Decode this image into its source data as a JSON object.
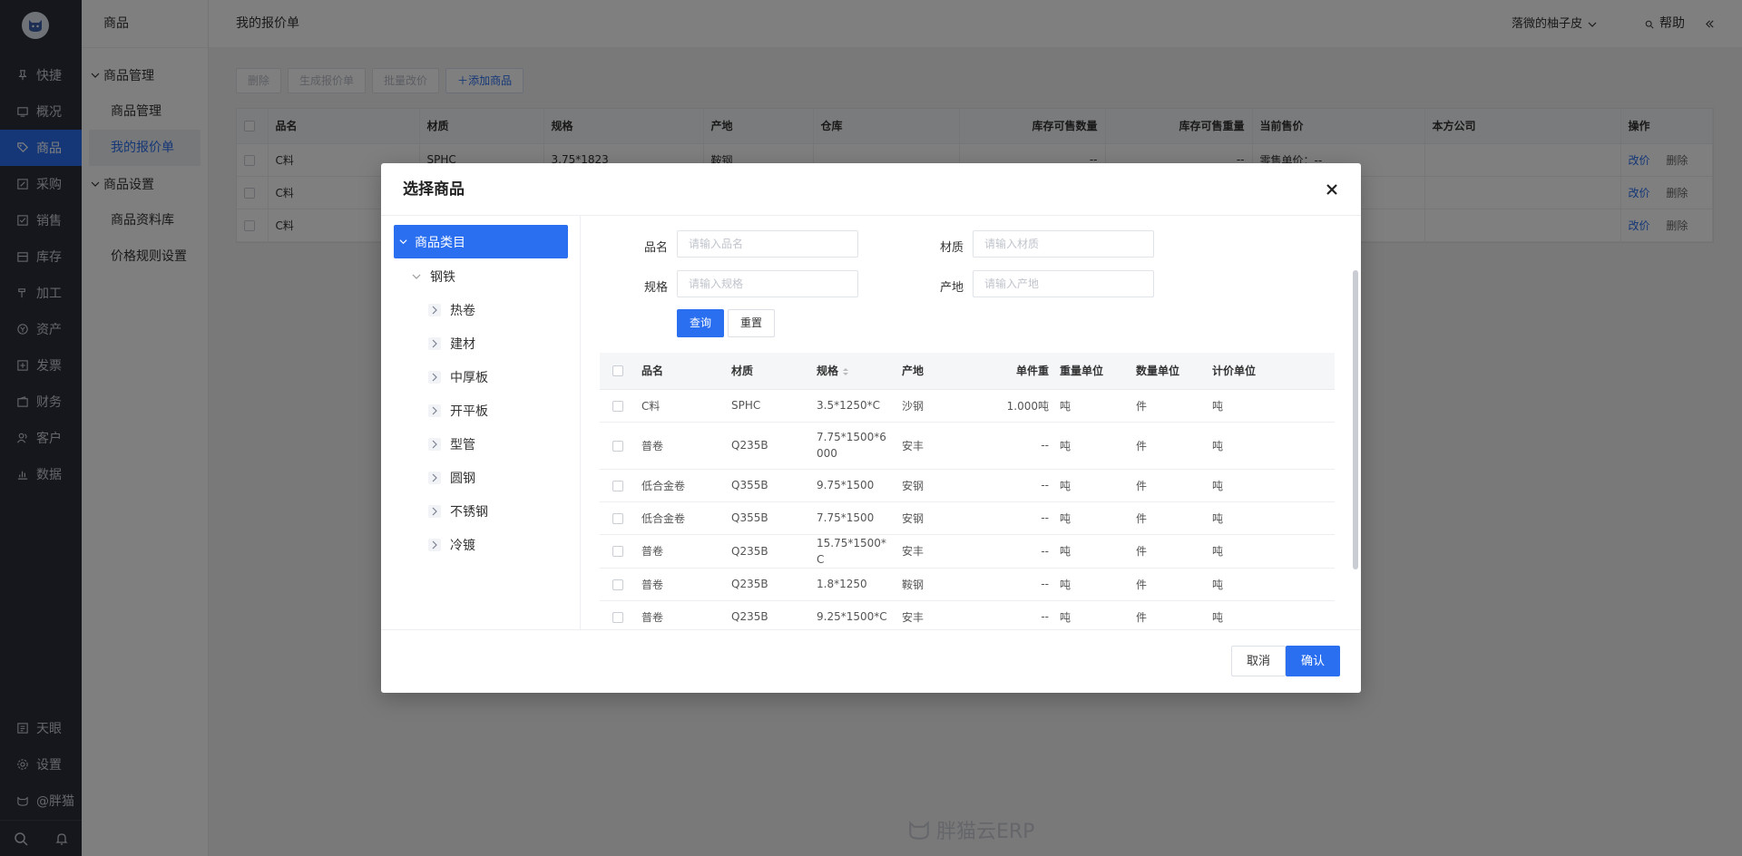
{
  "sidebar": {
    "items": [
      {
        "label": "快捷",
        "icon": "pin-icon"
      },
      {
        "label": "概况",
        "icon": "monitor-icon"
      },
      {
        "label": "商品",
        "icon": "tag-icon",
        "active": true
      },
      {
        "label": "采购",
        "icon": "edit-box-icon"
      },
      {
        "label": "销售",
        "icon": "check-box-icon"
      },
      {
        "label": "库存",
        "icon": "warehouse-icon"
      },
      {
        "label": "加工",
        "icon": "hammer-icon"
      },
      {
        "label": "资产",
        "icon": "coin-icon"
      },
      {
        "label": "发票",
        "icon": "invoice-icon"
      },
      {
        "label": "财务",
        "icon": "wallet-icon"
      },
      {
        "label": "客户",
        "icon": "user-icon"
      },
      {
        "label": "数据",
        "icon": "chart-icon"
      }
    ],
    "bottom": [
      {
        "label": "天眼",
        "icon": "document-icon"
      },
      {
        "label": "设置",
        "icon": "gear-icon"
      },
      {
        "label": "@胖猫",
        "icon": "cat-icon"
      }
    ]
  },
  "submenu": {
    "title": "商品",
    "groups": [
      {
        "label": "商品管理",
        "items": [
          "商品管理",
          "我的报价单"
        ]
      },
      {
        "label": "商品设置",
        "items": [
          "商品资料库",
          "价格规则设置"
        ]
      }
    ]
  },
  "topbar": {
    "breadcrumb": "我的报价单",
    "user": "落微的柚子皮",
    "help": "帮助"
  },
  "toolbar": {
    "delete": "删除",
    "generate": "生成报价单",
    "batch": "批量改价",
    "add": "添加商品"
  },
  "grid": {
    "headers": [
      "品名",
      "材质",
      "规格",
      "产地",
      "仓库",
      "库存可售数量",
      "库存可售重量",
      "当前售价",
      "本方公司",
      "操作"
    ],
    "rows": [
      [
        "C料",
        "SPHC",
        "3.75*1823",
        "鞍钢",
        "",
        "--",
        "--",
        "零售单价：--",
        ""
      ],
      [
        "C料",
        "",
        "",
        "",
        "",
        "",
        "",
        "",
        ""
      ],
      [
        "C料",
        "",
        "",
        "",
        "",
        "",
        "",
        "",
        ""
      ]
    ],
    "action_edit": "改价",
    "action_delete": "删除"
  },
  "watermark": "胖猫云ERP",
  "modal": {
    "title": "选择商品",
    "tree": {
      "root": "商品类目",
      "child": "钢铁",
      "leaves": [
        "热卷",
        "建材",
        "中厚板",
        "开平板",
        "型管",
        "圆钢",
        "不锈钢",
        "冷镀"
      ]
    },
    "filters": {
      "name_label": "品名",
      "name_placeholder": "请输入品名",
      "material_label": "材质",
      "material_placeholder": "请输入材质",
      "spec_label": "规格",
      "spec_placeholder": "请输入规格",
      "origin_label": "产地",
      "origin_placeholder": "请输入产地"
    },
    "query": "查询",
    "reset": "重置",
    "table": {
      "headers": [
        "品名",
        "材质",
        "规格",
        "产地",
        "单件重",
        "重量单位",
        "数量单位",
        "计价单位"
      ],
      "rows": [
        [
          "C料",
          "SPHC",
          "3.5*1250*C",
          "沙钢",
          "1.000吨",
          "吨",
          "件",
          "吨"
        ],
        [
          "普卷",
          "Q235B",
          "7.75*1500*6000",
          "安丰",
          "--",
          "吨",
          "件",
          "吨"
        ],
        [
          "低合金卷",
          "Q355B",
          "9.75*1500",
          "安钢",
          "--",
          "吨",
          "件",
          "吨"
        ],
        [
          "低合金卷",
          "Q355B",
          "7.75*1500",
          "安钢",
          "--",
          "吨",
          "件",
          "吨"
        ],
        [
          "普卷",
          "Q235B",
          "15.75*1500*C",
          "安丰",
          "--",
          "吨",
          "件",
          "吨"
        ],
        [
          "普卷",
          "Q235B",
          "1.8*1250",
          "鞍钢",
          "--",
          "吨",
          "件",
          "吨"
        ],
        [
          "普卷",
          "Q235B",
          "9.25*1500*C",
          "安丰",
          "--",
          "吨",
          "件",
          "吨"
        ]
      ]
    },
    "cancel": "取消",
    "confirm": "确认"
  },
  "colors": {
    "primary": "#2a6ff0",
    "sidebar_bg": "#2a2e38"
  }
}
